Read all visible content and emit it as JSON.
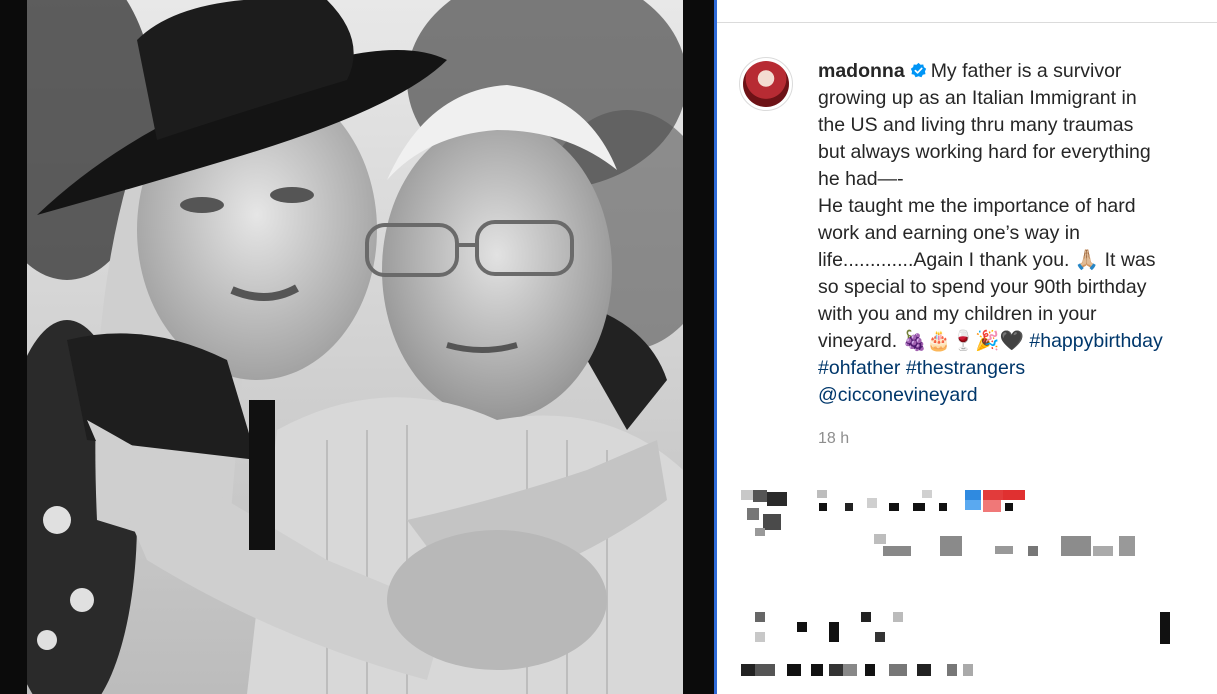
{
  "post": {
    "username": "madonna",
    "caption_lines": [
      "My father is a survivor",
      "growing up as an Italian Immigrant in",
      "the US and living thru many traumas",
      "but always working hard for everything",
      "he had—-",
      "He taught me the importance of hard",
      "work and earning one’s way in",
      "life.............Again I thank you. 🙏🏼 It was",
      "so special to spend your 90th birthday",
      "with you and my children in your",
      "vineyard. 🍇🎂🍷🎉🖤"
    ],
    "hashtags": [
      "#happybirthday",
      "#ohfather",
      "#thestrangers"
    ],
    "mention": "@cicconevineyard",
    "timestamp": "18 h"
  },
  "colors": {
    "accent_blue": "#2f6bd8",
    "link": "#00376b",
    "verified": "#0095f6"
  },
  "icons": {
    "verified": "verified-badge-icon"
  }
}
